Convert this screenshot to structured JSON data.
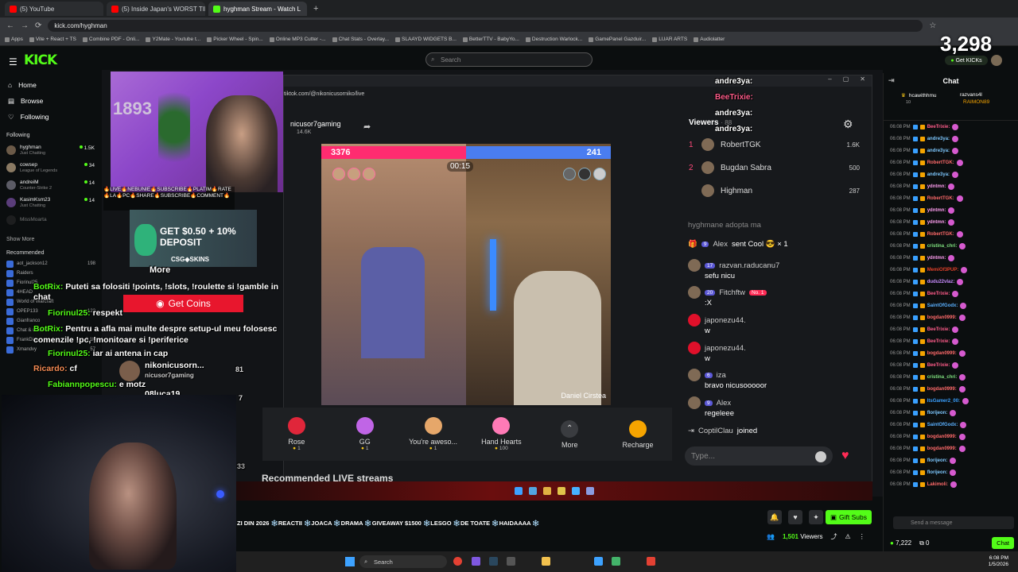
{
  "browser": {
    "tabs": [
      {
        "label": "(5) YouTube",
        "color": "#ff0000"
      },
      {
        "label": "(5) Inside Japan's WORST TINY",
        "color": "#ff0000"
      },
      {
        "label": "hyghman Stream - Watch L",
        "color": "#53fc18"
      }
    ],
    "url": "kick.com/hyghman",
    "bookmarks": [
      "Apps",
      "Vite + React + TS",
      "Combine PDF - Onli...",
      "Y2Mate - Youtube t...",
      "Picker Wheel - Spin...",
      "Online MP3 Cutter -...",
      "Chat Stats - Overlay...",
      "SLAAYD WIDGETS B...",
      "BetterTTV - BabyYo...",
      "Destruction Warlock...",
      "GamePanel Gazduir...",
      "LUAR ARTS",
      "Audiolatter"
    ]
  },
  "header": {
    "logo": "KICK",
    "search_placeholder": "Search",
    "counter": "3,298",
    "get_kicks": "Get KICKs"
  },
  "sidebar": {
    "nav": [
      {
        "label": "Home",
        "icon": "home-icon"
      },
      {
        "label": "Browse",
        "icon": "browse-icon"
      },
      {
        "label": "Following",
        "icon": "heart-icon"
      }
    ],
    "following_title": "Following",
    "following": [
      {
        "name": "hyghman",
        "category": "Just Chatting",
        "count": "1.5K",
        "color": "#6b5a48"
      },
      {
        "name": "cowsep",
        "category": "League of Legends",
        "count": "34",
        "color": "#8a7a63"
      },
      {
        "name": "andreiM",
        "category": "Counter-Strike 2",
        "count": "14",
        "color": "#5c5c66"
      },
      {
        "name": "KasimKsm23",
        "category": "Just Chatting",
        "count": "14",
        "color": "#5a3d7a"
      },
      {
        "name": "MissMoarta",
        "category": "",
        "count": "",
        "color": "#333"
      }
    ],
    "show_more": "Show More",
    "recommended_title": "Recommended",
    "recommended": [
      {
        "name": "aot_jackson12",
        "count": "198"
      },
      {
        "name": "Raiders",
        "count": ""
      },
      {
        "name": "Fiorinul25",
        "count": ""
      },
      {
        "name": "4HEAD",
        "count": ""
      },
      {
        "name": "World of Warcraft",
        "count": ""
      },
      {
        "name": "OPEP133",
        "count": "122"
      },
      {
        "name": "Gianfranco",
        "count": ""
      },
      {
        "name": "Chat & Casino",
        "count": ""
      },
      {
        "name": "FrankDimes",
        "count": "2.1K"
      },
      {
        "name": "Xmandvy",
        "count": "57"
      }
    ]
  },
  "pip": {
    "text": "1893"
  },
  "overlay": {
    "live_banner": "🔥LIVE🔥NEBUNIE🔥SUBSCRIBE🔥PLATIM🔥RATE🔥LA🔥PC🔥SHARE🔥SUBSCRIBE🔥COMMENT🔥",
    "csg_promo": "GET $0.50 + 10% DEPOSIT",
    "csg_price": "$0.50",
    "csg_brand": "CSG◈SKINS",
    "more": "More",
    "get_coins": "Get Coins",
    "chat": [
      {
        "user": "BotRix:",
        "text": "Puteti sa folositi !points, !slots, !roulette si !gamble in chat"
      },
      {
        "user": "Fiorinul25:",
        "text": "respekt"
      },
      {
        "user": "BotRix:",
        "text": "Pentru a afla mai multe despre setup-ul meu folosesc comenzile !pc, !monitoare si !periferice"
      },
      {
        "user": "Fiorinul25:",
        "text": "iar ai antena in cap"
      },
      {
        "user": "Ricardo:",
        "text": "cf"
      },
      {
        "user": "Fabiannpopescu:",
        "text": "e motz"
      }
    ],
    "nikonicu_name": "nikonicusorn...",
    "nikonicu_sub": "nicusor7gaming",
    "nikonicu_num": "81",
    "odluca": "08luca19",
    "odluca_num": "7",
    "num33": "33"
  },
  "tiktok": {
    "url": "tiktok.com/@nikonicusorniko/live",
    "username": "nicusor7gaming",
    "views": "14.6K",
    "score_left": "3376",
    "score_right": "241",
    "timer": "00:15",
    "opponent": "Daniel Cirstea",
    "gifts": [
      {
        "name": "Rose",
        "cost": "1",
        "color": "#e0263a"
      },
      {
        "name": "GG",
        "cost": "1",
        "color": "#c065e6"
      },
      {
        "name": "You're aweso...",
        "cost": "1",
        "color": "#e6a76a"
      },
      {
        "name": "Hand Hearts",
        "cost": "100",
        "color": "#ff7ab6"
      }
    ],
    "more": "More",
    "recharge": "Recharge",
    "recommended": "Recommended LIVE streams",
    "viewers_label": "Viewers",
    "viewers_count": "· 88",
    "viewer_list": [
      {
        "rank": "1",
        "name": "RobertTGK",
        "count": "1.6K"
      },
      {
        "rank": "2",
        "name": "Bugdan Sabra",
        "count": "500"
      },
      {
        "rank": "",
        "name": "Highman",
        "count": "287"
      }
    ],
    "adopt": "hyghmane adopta ma",
    "messages": [
      {
        "badge": "9",
        "name": "Alex",
        "text": "sent Cool 😎 × 1",
        "inline": true
      },
      {
        "badge": "17",
        "name": "razvan.raducanu7",
        "text": "sefu nicu"
      },
      {
        "badge": "20",
        "name": "Fitchftw",
        "tag": "No. 1",
        "text": ":X"
      },
      {
        "badge": "",
        "name": "japonezu44.",
        "text": "w"
      },
      {
        "badge": "",
        "name": "japonezu44.",
        "text": "w"
      },
      {
        "badge": "6",
        "name": "iza",
        "text": "bravo nicusooooor"
      },
      {
        "badge": "9",
        "name": "Alex",
        "text": "regeleee"
      }
    ],
    "joined_name": "CoptilClau",
    "joined": "joined",
    "type_placeholder": "Type...",
    "floating": [
      "andre3ya:",
      "BeeTrixie:",
      "andre3ya:",
      "andre3ya:"
    ]
  },
  "stream": {
    "marquee": "ZI DIN 2026 ❄️REACTII ❄️JOACA ❄️DRAMA ❄️GIVEAWAY $1500 ❄️LESGO ❄️DE TOATE ❄️HAIDAAAA ❄️",
    "gift_subs": "Gift Subs",
    "viewers": "1,501",
    "viewers_label": "Viewers"
  },
  "chat": {
    "title": "Chat",
    "pinned": [
      {
        "name": "hcawithhmu",
        "count": "10"
      },
      {
        "name": "razvans4l",
        "count": "12"
      },
      {
        "name": "RAIMON89",
        "count": "11"
      }
    ],
    "messages": [
      {
        "time": "06:08 PM",
        "user": "BeeTrixie:",
        "color": "#ff5c8a"
      },
      {
        "time": "06:08 PM",
        "user": "andre3ya:",
        "color": "#7ec8ff"
      },
      {
        "time": "06:08 PM",
        "user": "andre3ya:",
        "color": "#7ec8ff"
      },
      {
        "time": "06:08 PM",
        "user": "RobertTGK:",
        "color": "#ff6a6a"
      },
      {
        "time": "06:08 PM",
        "user": "andre3ya:",
        "color": "#7ec8ff"
      },
      {
        "time": "06:08 PM",
        "user": "ydntmn:",
        "color": "#ff9ef0"
      },
      {
        "time": "06:08 PM",
        "user": "RobertTGK:",
        "color": "#ff6a6a"
      },
      {
        "time": "06:08 PM",
        "user": "ydntmn:",
        "color": "#ff9ef0"
      },
      {
        "time": "06:08 PM",
        "user": "ydntmn:",
        "color": "#ff9ef0"
      },
      {
        "time": "06:08 PM",
        "user": "RobertTGK:",
        "color": "#ff6a6a"
      },
      {
        "time": "06:08 PM",
        "user": "cristina_chri:",
        "color": "#7ee07e"
      },
      {
        "time": "06:08 PM",
        "user": "ydntmn:",
        "color": "#ff9ef0"
      },
      {
        "time": "06:08 PM",
        "user": "MemiOf3PUP:",
        "color": "#e0402a"
      },
      {
        "time": "06:08 PM",
        "user": "dudu22vlaz:",
        "color": "#c98cff"
      },
      {
        "time": "06:08 PM",
        "user": "BeeTrixie:",
        "color": "#ff5c8a"
      },
      {
        "time": "06:08 PM",
        "user": "SaintOfGodx:",
        "color": "#5ab0ff"
      },
      {
        "time": "06:08 PM",
        "user": "bogdan0999:",
        "color": "#ff6a6a"
      },
      {
        "time": "06:08 PM",
        "user": "BeeTrixie:",
        "color": "#ff5c8a"
      },
      {
        "time": "06:08 PM",
        "user": "BeeTrixie:",
        "color": "#ff5c8a"
      },
      {
        "time": "06:08 PM",
        "user": "bogdan0999:",
        "color": "#ff6a6a"
      },
      {
        "time": "06:08 PM",
        "user": "BeeTrixie:",
        "color": "#ff5c8a"
      },
      {
        "time": "06:08 PM",
        "user": "cristina_chri:",
        "color": "#7ee07e"
      },
      {
        "time": "06:08 PM",
        "user": "bogdan0999:",
        "color": "#ff6a6a"
      },
      {
        "time": "06:08 PM",
        "user": "ItsGamer2_00:",
        "color": "#3aa0ff"
      },
      {
        "time": "06:08 PM",
        "user": "florijeon:",
        "color": "#7ec8ff"
      },
      {
        "time": "06:08 PM",
        "user": "SaintOfGodx:",
        "color": "#5ab0ff"
      },
      {
        "time": "06:08 PM",
        "user": "bogdan0999:",
        "color": "#ff6a6a"
      },
      {
        "time": "06:08 PM",
        "user": "bogdan0999:",
        "color": "#ff6a6a"
      },
      {
        "time": "06:08 PM",
        "user": "florijeon:",
        "color": "#7ec8ff"
      },
      {
        "time": "06:08 PM",
        "user": "florijeon:",
        "color": "#7ec8ff"
      },
      {
        "time": "06:08 PM",
        "user": "Lakimoli:",
        "color": "#ff6a6a"
      }
    ],
    "input_placeholder": "Send a message",
    "points": "7,222",
    "zero": "0",
    "chat_button": "Chat"
  },
  "taskbar": {
    "search": "Search",
    "time": "6:08 PM",
    "date": "1/5/2026"
  }
}
